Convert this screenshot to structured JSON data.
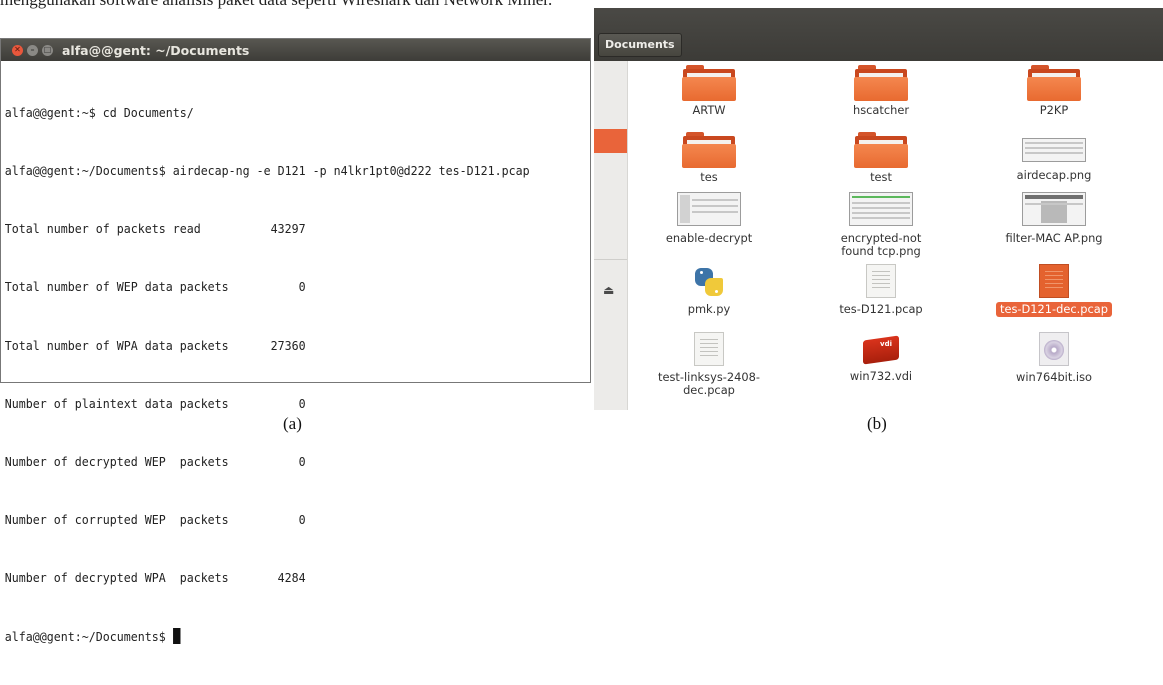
{
  "top_caption": "menggunakan software analisis paket data seperti Wireshark dan Network Miner.",
  "terminal": {
    "title": "alfa@@gent: ~/Documents",
    "lines": [
      "alfa@@gent:~$ cd Documents/",
      "alfa@@gent:~/Documents$ airdecap-ng -e D121 -p n4lkr1pt0@d222 tes-D121.pcap",
      "Total number of packets read          43297",
      "Total number of WEP data packets          0",
      "Total number of WPA data packets      27360",
      "Number of plaintext data packets          0",
      "Number of decrypted WEP  packets          0",
      "Number of corrupted WEP  packets          0",
      "Number of decrypted WPA  packets       4284",
      "alfa@@gent:~/Documents$ "
    ]
  },
  "file_manager": {
    "path_button": "Documents",
    "accent_color": "#e9643a",
    "items": [
      {
        "label": "ARTW",
        "icon": "folder-icon"
      },
      {
        "label": "hscatcher",
        "icon": "folder-icon"
      },
      {
        "label": "P2KP",
        "icon": "folder-icon"
      },
      {
        "label": "tes",
        "icon": "folder-icon"
      },
      {
        "label": "test",
        "icon": "folder-icon"
      },
      {
        "label": "airdecap.png",
        "icon": "image-thumbnail-icon"
      },
      {
        "label": "enable-decrypt",
        "icon": "image-thumbnail-icon"
      },
      {
        "label": "encrypted-not\nfound tcp.png",
        "icon": "image-thumbnail-icon"
      },
      {
        "label": "filter-MAC AP.png",
        "icon": "image-thumbnail-icon"
      },
      {
        "label": "pmk.py",
        "icon": "python-file-icon"
      },
      {
        "label": "tes-D121.pcap",
        "icon": "text-file-icon"
      },
      {
        "label": "tes-D121-dec.pcap",
        "icon": "text-file-icon",
        "selected": true
      },
      {
        "label": "test-linksys-2408-\ndec.pcap",
        "icon": "text-file-icon"
      },
      {
        "label": "win732.vdi",
        "icon": "vdi-file-icon"
      },
      {
        "label": "win764bit.iso",
        "icon": "disc-image-icon"
      }
    ]
  },
  "captions": {
    "a": "(a)",
    "b": "(b)"
  }
}
